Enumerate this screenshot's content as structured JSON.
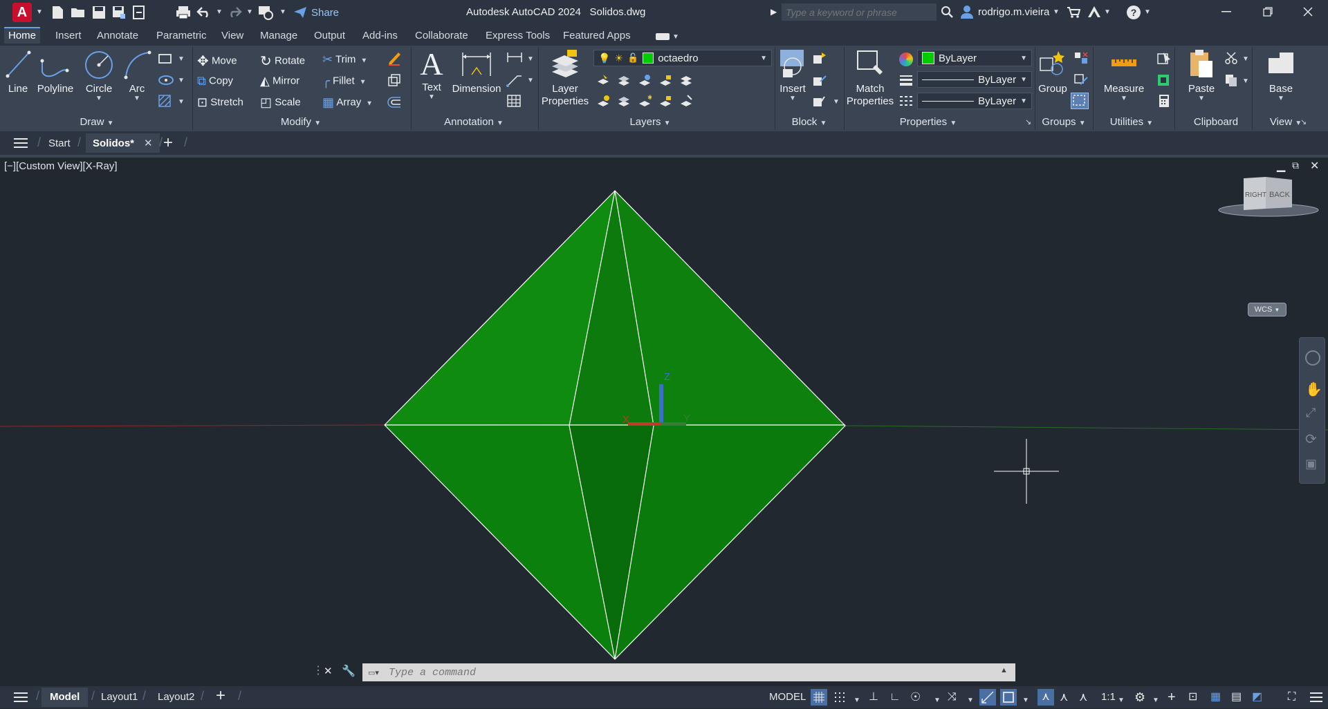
{
  "titlebar": {
    "app_letter": "A",
    "share_label": "Share",
    "title": "Autodesk AutoCAD 2024",
    "filename": "Solidos.dwg",
    "search_placeholder": "Type a keyword or phrase",
    "user": "rodrigo.m.vieira"
  },
  "ribbon_tabs": [
    "Home",
    "Insert",
    "Annotate",
    "Parametric",
    "View",
    "Manage",
    "Output",
    "Add-ins",
    "Collaborate",
    "Express Tools",
    "Featured Apps"
  ],
  "draw": {
    "title": "Draw",
    "line": "Line",
    "polyline": "Polyline",
    "circle": "Circle",
    "arc": "Arc"
  },
  "modify": {
    "title": "Modify",
    "move": "Move",
    "rotate": "Rotate",
    "trim": "Trim",
    "copy": "Copy",
    "mirror": "Mirror",
    "fillet": "Fillet",
    "stretch": "Stretch",
    "scale": "Scale",
    "array": "Array"
  },
  "annotation": {
    "title": "Annotation",
    "text": "Text",
    "dimension": "Dimension"
  },
  "layers": {
    "title": "Layers",
    "layer_properties_1": "Layer",
    "layer_properties_2": "Properties",
    "current_layer": "octaedro"
  },
  "block": {
    "title": "Block",
    "insert": "Insert"
  },
  "properties": {
    "title": "Properties",
    "match_1": "Match",
    "match_2": "Properties",
    "color": "ByLayer",
    "linetype": "ByLayer",
    "lineweight": "ByLayer"
  },
  "groups": {
    "title": "Groups",
    "group": "Group"
  },
  "utilities": {
    "title": "Utilities",
    "measure": "Measure"
  },
  "clipboard": {
    "title": "Clipboard",
    "paste": "Paste"
  },
  "view": {
    "title": "View",
    "base": "Base"
  },
  "filetabs": {
    "start": "Start",
    "active": "Solidos*"
  },
  "viewport": {
    "label": "[−][Custom View][X-Ray]",
    "viewcube_right": "RIGHT",
    "viewcube_back": "BACK",
    "wcs": "WCS",
    "ucs_x": "X",
    "ucs_y": "Y",
    "ucs_z": "Z"
  },
  "command": {
    "placeholder": "Type a command"
  },
  "status": {
    "model_tab": "Model",
    "layout1": "Layout1",
    "layout2": "Layout2",
    "model_space": "MODEL",
    "scale": "1:1"
  },
  "colors": {
    "accent": "#6aa0e6",
    "solid_green": "#0f8a0f",
    "brand_red": "#c8102e",
    "layer_color": "#00cc00"
  }
}
